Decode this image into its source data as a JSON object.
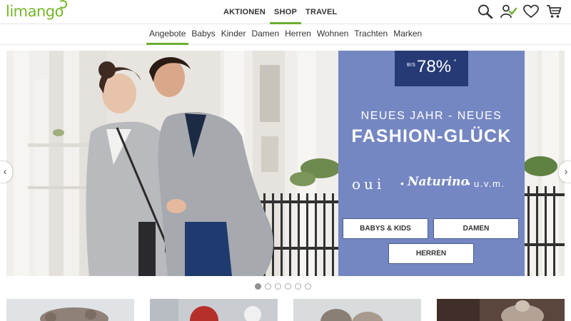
{
  "header": {
    "logo": "limango",
    "nav": [
      {
        "label": "AKTIONEN"
      },
      {
        "label": "SHOP"
      },
      {
        "label": "TRAVEL"
      }
    ],
    "icons": [
      "search-icon",
      "account-check-icon",
      "heart-icon",
      "cart-icon"
    ]
  },
  "subnav": {
    "items": [
      {
        "label": "Angebote"
      },
      {
        "label": "Babys"
      },
      {
        "label": "Kinder"
      },
      {
        "label": "Damen"
      },
      {
        "label": "Herren"
      },
      {
        "label": "Wohnen"
      },
      {
        "label": "Trachten"
      },
      {
        "label": "Marken"
      }
    ]
  },
  "hero": {
    "badge": {
      "prefix": "BIS",
      "value": "78%",
      "mark": "*"
    },
    "line1": "NEUES JAHR - NEUES",
    "line2": "FASHION-GLÜCK",
    "brands": {
      "brand1": "oui",
      "sep": "•",
      "brand2": "Naturino",
      "brand3": "u.v.m."
    },
    "buttons": {
      "babys": "BABYS & KIDS",
      "damen": "DAMEN",
      "herren": "HERREN"
    },
    "arrows": {
      "prev": "‹",
      "next": "›"
    }
  },
  "carousel": {
    "slides": 6,
    "active": 1
  },
  "colors": {
    "accent_green": "#6cae30",
    "promo_blue": "#7587c2",
    "badge_navy": "#263a76"
  }
}
